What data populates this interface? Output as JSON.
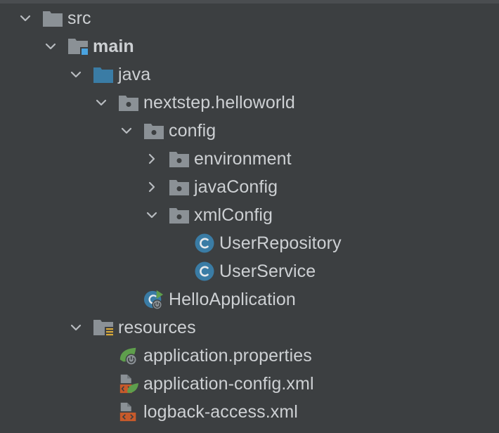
{
  "tree": {
    "items": [
      {
        "label": "src",
        "expanded": true,
        "icon": "folder-icon"
      },
      {
        "label": "main",
        "expanded": true,
        "icon": "source-root-folder-icon"
      },
      {
        "label": "java",
        "expanded": true,
        "icon": "blue-source-folder-icon"
      },
      {
        "label": "nextstep.helloworld",
        "expanded": true,
        "icon": "package-icon"
      },
      {
        "label": "config",
        "expanded": true,
        "icon": "package-icon"
      },
      {
        "label": "environment",
        "expanded": false,
        "icon": "package-icon"
      },
      {
        "label": "javaConfig",
        "expanded": false,
        "icon": "package-icon"
      },
      {
        "label": "xmlConfig",
        "expanded": true,
        "icon": "package-icon"
      },
      {
        "label": "UserRepository",
        "icon": "java-class-icon"
      },
      {
        "label": "UserService",
        "icon": "java-class-icon"
      },
      {
        "label": "HelloApplication",
        "icon": "spring-boot-application-icon"
      },
      {
        "label": "resources",
        "expanded": true,
        "icon": "resources-folder-icon"
      },
      {
        "label": "application.properties",
        "icon": "spring-properties-icon"
      },
      {
        "label": "application-config.xml",
        "icon": "spring-xml-icon"
      },
      {
        "label": "logback-access.xml",
        "icon": "xml-file-icon"
      }
    ]
  },
  "colors": {
    "background": "#3c3f41",
    "text": "#cdd0d3",
    "folder": "#8b9196",
    "source_blue": "#3a7ca5",
    "class_circle": "#3a7ca5",
    "spring_green": "#5e9e4c",
    "xml_orange": "#c75a2b"
  }
}
